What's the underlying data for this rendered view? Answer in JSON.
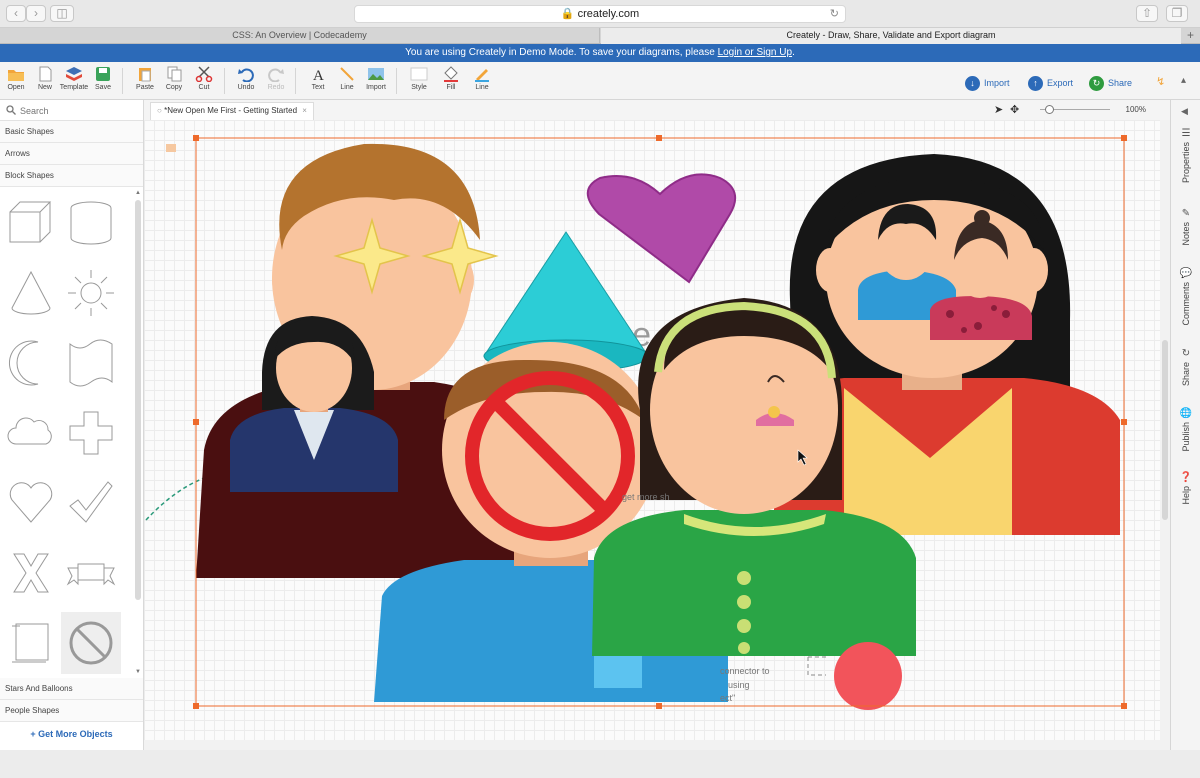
{
  "browser": {
    "url": "creately.com",
    "tabs": [
      "CSS: An Overview | Codecademy",
      "Creately - Draw, Share, Validate and Export diagram"
    ]
  },
  "demo_banner": {
    "text": "You are using Creately in Demo Mode. To save your diagrams, please ",
    "link": "Login or Sign Up",
    "suffix": "."
  },
  "toolbar": {
    "items": [
      "Open",
      "New",
      "Template",
      "Save",
      "Paste",
      "Copy",
      "Cut",
      "Undo",
      "Redo",
      "Text",
      "Line",
      "Import",
      "Style",
      "Fill",
      "Line"
    ],
    "import_label": "Import",
    "export_label": "Export",
    "share_label": "Share"
  },
  "sidebar": {
    "search_placeholder": "Search",
    "categories_top": [
      "Basic Shapes",
      "Arrows",
      "Block Shapes"
    ],
    "categories_bottom": [
      "Stars And Balloons",
      "People Shapes"
    ],
    "get_more": "+ Get More Objects"
  },
  "document": {
    "tab_title": "*New Open Me First - Getting Started",
    "tab_close": "×",
    "zoom": "100%"
  },
  "canvas_text": {
    "welcome": "Welcome",
    "get_more_snippet": "get more sh",
    "connector_1": "connector to",
    "connector_2": "using",
    "connector_3": "ect\""
  },
  "right_panel": [
    "Properties",
    "Notes",
    "Comments",
    "Share",
    "Publish",
    "Help"
  ],
  "colors": {
    "brand_blue": "#2c6ab8",
    "selection": "#ee6a2b",
    "heart": "#b04aa8",
    "cone": "#20c4cc",
    "no_sign": "#e2262a"
  }
}
